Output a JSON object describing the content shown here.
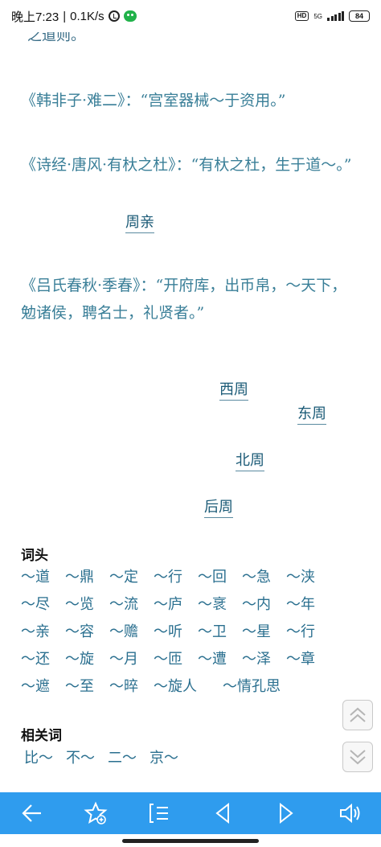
{
  "status": {
    "time": "晚上7:23",
    "speed": "0.1K/s",
    "hd": "HD",
    "net_type": "5G",
    "battery": "84"
  },
  "content": {
    "cut_line": "之道则。",
    "quotes": [
      "《韩非子·难二》：“宫室器械～于资用。”",
      "《诗经·唐风·有杕之杜》：“有杕之杜，生于道～。”",
      "《吕氏春秋·季春》：“开府库，出币帛，～天下，勉诸侯，聘名士，礼贤者。”"
    ],
    "links": {
      "zhouqin": "周亲",
      "xizhou": "西周",
      "dongzhou": "东周",
      "beizhou": "北周",
      "houzhou": "后周"
    },
    "prefix_title": "词头",
    "prefix_words": [
      "～道",
      "～鼎",
      "～定",
      "～行",
      "～回",
      "～急",
      "～浃",
      "～尽",
      "～览",
      "～流",
      "～庐",
      "～衺",
      "～内",
      "～年",
      "～亲",
      "～容",
      "～赡",
      "～听",
      "～卫",
      "～星",
      "～行",
      "～还",
      "～旋",
      "～月",
      "～匝",
      "～遭",
      "～泽",
      "～章",
      "～遮",
      "～至",
      "～晬",
      "～旋人",
      "～情孔思"
    ],
    "related_title": "相关词",
    "related_words": [
      "比～",
      "不～",
      "二～",
      "京～"
    ]
  },
  "colors": {
    "toolbar": "#2f9cee",
    "quote_text": "#3a7f98",
    "link_text": "#1a5a76"
  },
  "icons": {
    "float_up": "double-chevron-up-icon",
    "float_down": "double-chevron-down-icon",
    "toolbar": [
      "back-arrow-icon",
      "star-add-icon",
      "toc-list-icon",
      "prev-triangle-icon",
      "next-triangle-icon",
      "speaker-icon"
    ]
  }
}
